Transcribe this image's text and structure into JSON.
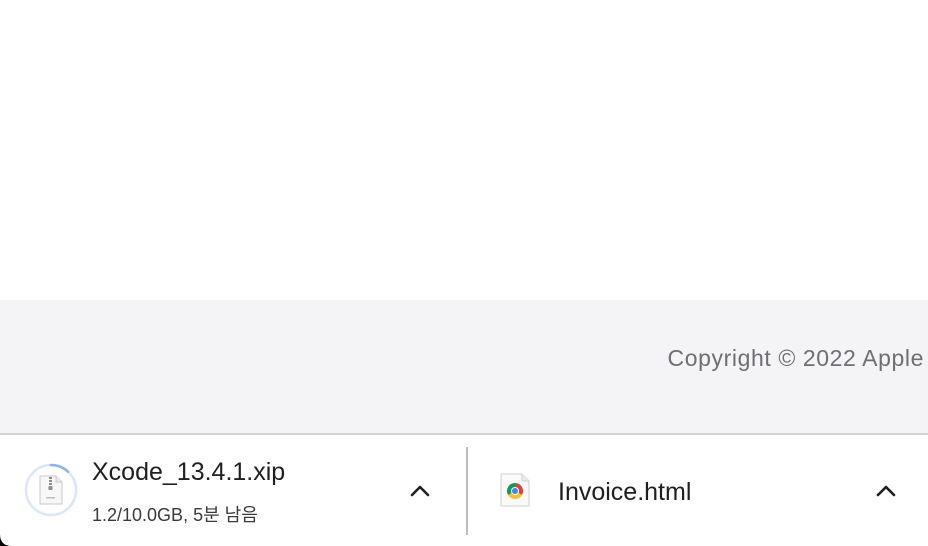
{
  "footer": {
    "copyright": "Copyright © 2022 Apple"
  },
  "downloads": {
    "items": [
      {
        "file_name": "Xcode_13.4.1.xip",
        "status": "1.2/10.0GB, 5분 남음",
        "progress": 0.12,
        "icon": "zip-archive-icon",
        "menu_icon": "chevron-up-icon"
      },
      {
        "file_name": "Invoice.html",
        "icon": "chrome-html-file-icon",
        "menu_icon": "chevron-up-icon"
      }
    ]
  },
  "colors": {
    "footer_bg": "#f4f4f6",
    "progress_ring": "#8fb3f0",
    "progress_track": "#dbe6fb"
  }
}
